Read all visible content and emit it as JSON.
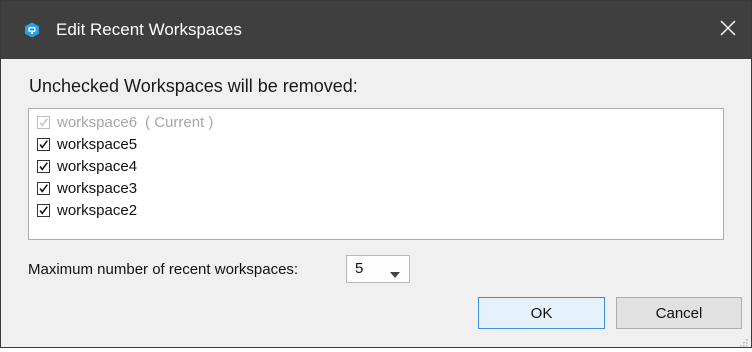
{
  "window": {
    "title": "Edit Recent Workspaces",
    "icon": "app-logo-icon",
    "titlebar_color": "#3f3f3f"
  },
  "heading": "Unchecked Workspaces will be removed:",
  "workspaces": [
    {
      "name": "workspace6",
      "suffix": "( Current )",
      "checked": true,
      "disabled": true
    },
    {
      "name": "workspace5",
      "suffix": "",
      "checked": true,
      "disabled": false
    },
    {
      "name": "workspace4",
      "suffix": "",
      "checked": true,
      "disabled": false
    },
    {
      "name": "workspace3",
      "suffix": "",
      "checked": true,
      "disabled": false
    },
    {
      "name": "workspace2",
      "suffix": "",
      "checked": true,
      "disabled": false
    }
  ],
  "max_recent": {
    "label": "Maximum number of recent workspaces:",
    "value": "5"
  },
  "buttons": {
    "ok": "OK",
    "cancel": "Cancel"
  },
  "colors": {
    "accent": "#3c8fd8",
    "disabled_text": "#a6a6a6"
  }
}
